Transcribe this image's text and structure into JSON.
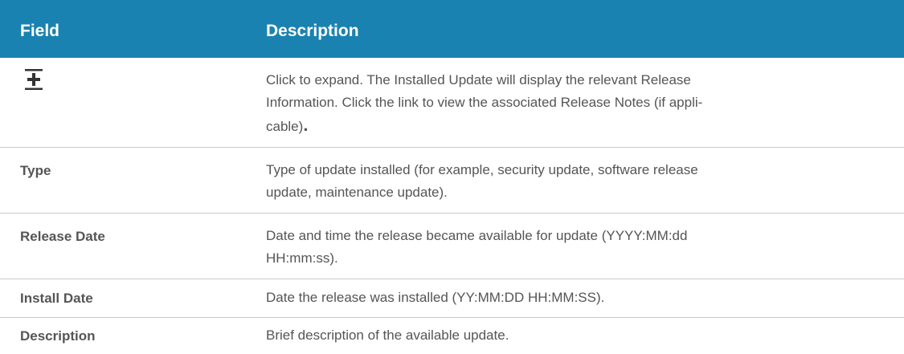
{
  "header": {
    "field": "Field",
    "description": "Description"
  },
  "rows": [
    {
      "field_icon": "plus-icon",
      "description": "Click to expand. The Installed Update will display the relevant Release Information. Click the link to view the associated Release Notes (if appli-cable)",
      "description_line1": "Click to expand. The Installed Update will display the relevant Release",
      "description_line2": "Information. Click the link to view the associated Release Notes (if appli-",
      "description_line3": "cable)",
      "description_end": "."
    },
    {
      "field": "Type",
      "description_line1": "Type of update installed (for example, security update, software release",
      "description_line2": "update, maintenance update)."
    },
    {
      "field": "Release Date",
      "description_line1": "Date and time the release became available for update (YYYY:MM:dd",
      "description_line2": "HH:mm:ss)."
    },
    {
      "field": "Install Date",
      "description_line1": "Date the release was installed (YY:MM:DD HH:MM:SS)."
    },
    {
      "field": "Description",
      "description_line1": "Brief description of the available update."
    }
  ],
  "colors": {
    "header_bg": "#1a82b0",
    "header_text": "#ffffff",
    "body_text": "#555555",
    "row_border": "#c9c9c9"
  }
}
